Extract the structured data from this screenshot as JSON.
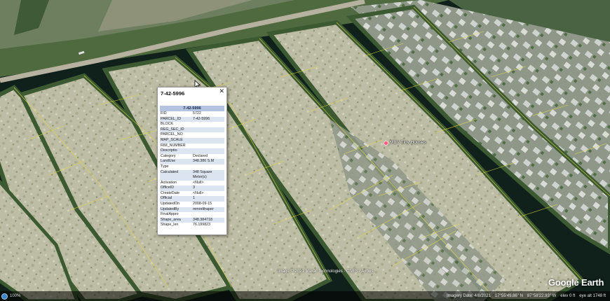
{
  "popup": {
    "title": "7-42-5996",
    "header": "7-42-5996",
    "close_icon": "close-icon",
    "attributes": [
      {
        "key": "FID",
        "value": "5722"
      },
      {
        "key": "PARCEL_ID",
        "value": "7-42-5996"
      },
      {
        "key": "BLOCK",
        "value": ""
      },
      {
        "key": "REG_SEC_ID",
        "value": ""
      },
      {
        "key": "PARCEL_NO",
        "value": ""
      },
      {
        "key": "MAP_SCALE",
        "value": ""
      },
      {
        "key": "RIM_NUMBER",
        "value": ""
      },
      {
        "key": "Descriptio",
        "value": ""
      },
      {
        "key": "Category",
        "value": "Declared"
      },
      {
        "key": "LandUse",
        "value": "348.386 S.M"
      },
      {
        "key": "Type",
        "value": ""
      },
      {
        "key": "Calculated",
        "value": "348 Square Meter(s)"
      },
      {
        "key": "Activation",
        "value": "<Null>"
      },
      {
        "key": "OfficeID",
        "value": "3"
      },
      {
        "key": "CreateDate",
        "value": "<Null>"
      },
      {
        "key": "Official",
        "value": "1"
      },
      {
        "key": "UpdatedOn",
        "value": "2008-09-15"
      },
      {
        "key": "UpdatedBy",
        "value": "mmrelthaper"
      },
      {
        "key": "FinalAppro",
        "value": ""
      },
      {
        "key": "Shape_area",
        "value": "348.384718"
      },
      {
        "key": "Shape_len",
        "value": "76.199823"
      }
    ]
  },
  "map": {
    "place_label": "MBV Tiny Houses",
    "imagery_credit": "Image © 2021 Maxar Technologies · CNES / Airbus",
    "logo": "Google Earth",
    "colors": {
      "water": "#0f1e14",
      "land_sand": "#b9b8a0",
      "vegetation": "#5f7a4a",
      "parcel_lines": "#e6dc3c",
      "pin": "#ff5a7a"
    }
  },
  "status_bar": {
    "globe_icon": "globe-icon",
    "stream_pct": "100%",
    "imagery_date": "Imagery Date: 4/8/2021",
    "lat": "17°55'49.86\" N",
    "lon": "87°58'22.93\" W",
    "elev": "elev 0 ft",
    "eye_alt": "eye alt 1748 ft"
  }
}
